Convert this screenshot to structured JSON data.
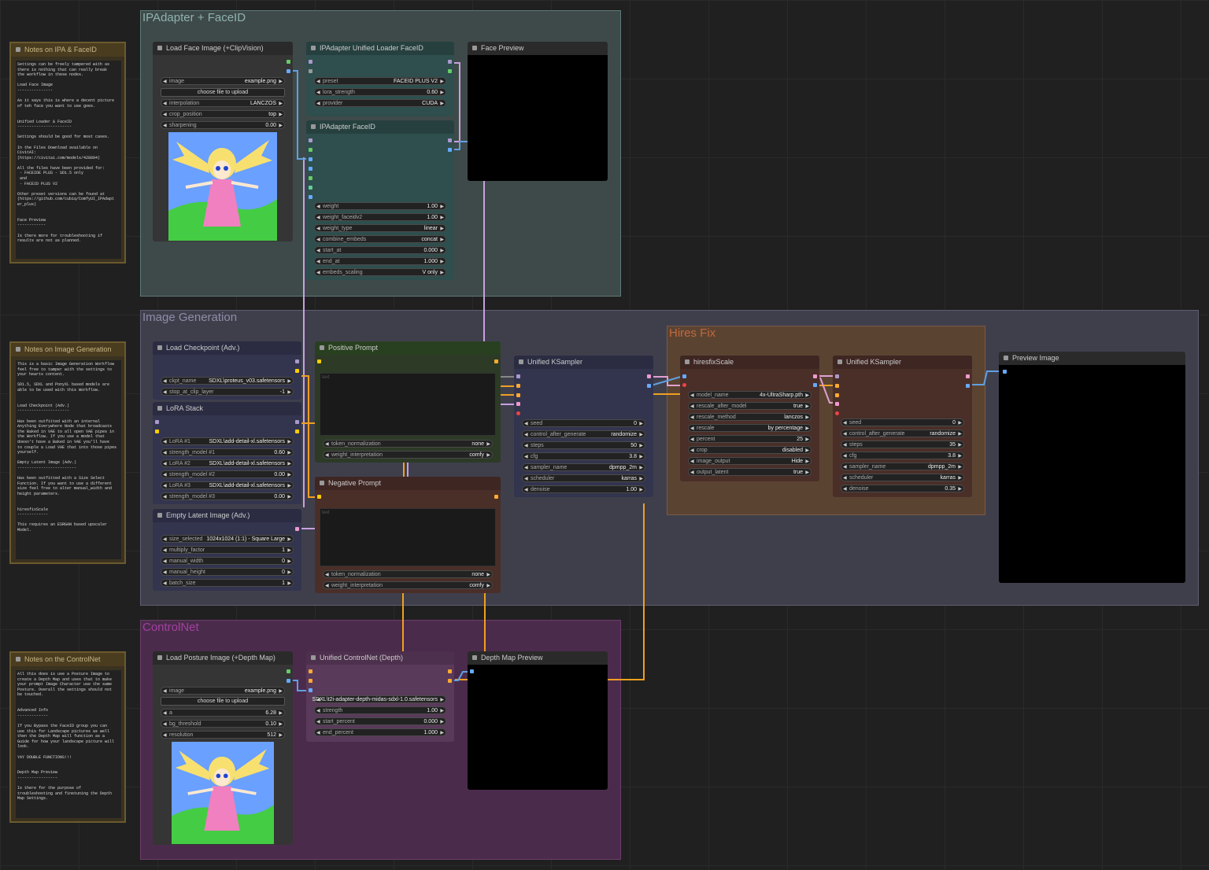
{
  "groups": {
    "ipadapter": "IPAdapter + FaceID",
    "image_generation": "Image Generation",
    "hires_fix": "Hires Fix",
    "controlnet": "ControlNet"
  },
  "notes": {
    "ipa": {
      "title": "Notes on IPA & FaceID",
      "body": "Settings can be freely tampered with as\nthere is nothing that can really break\nthe workflow in these nodes.\n\nLoad Face Image\n---------------\n\nAs it says this is where a decent picture\nof teh face you want to use goes.\n\n\nUnified Loader & FaceID\n-----------------------\n\nSettings should be good for most cases.\n\nIn the Files Download available on\nCivitAI:\n(https://civitai.com/models/428894)\n\nAll the files have been provided for:\n - FACEIDE PLUS - SD1.5 only\n and\n - FACEID PLUS V2\n\nOther preset versions can be found at\n(https://github.com/cubiq/ComfyUI_IPAdapt\ner_plus)\n\n\nFace Preview\n------------\n\nIs there more for troubleshooting if\nresults are not as planned."
    },
    "imggen": {
      "title": "Notes on Image Generation",
      "body": "This is a basic Image Generation Workflow\nfeel free to tamper with the settings to\nyour hearts content.\n\nSD1.5, SDXL and PonyXL based models are\nable to be used with this Workflow.\n\n\nLoad Checkpoint (Adv.)\n----------------------\n\nHas been outfitted with an internal\nAnything Everywhere Node that broadcasts\nthe Baked in VAE to all open VAE pipes in\nthe Workflow. If you use a model that\ndoesn't have a Baked in VAE you'll have\nto couple a Load VAE that into those pipes\nyourself.\n\nEmpty Latent Image (Adv.)\n-------------------------\n\nHas been outfitted with a Size Select\nFunction. If you want to use a different\nsize feel free to alter manual_width and\nheight parameters.\n\n\nhiresfixScale\n-------------\n\nThis requires an ESRGAN based upscaler\nModel."
    },
    "controlnet": {
      "title": "Notes on the ControlNet",
      "body": "All this does is use a Posture Image to\ncreate a Depth Map and uses that to make\nyour prompt Image Character use the same\nPosture. Overall the settings should not\nbe touched.\n\n\nAdvanced Info\n-------------\n\nIf you Bypass the FaceID group you can\nuse this for Landscape pictures as well\nthen the Depth Map will function as a\nGuide for how your landscape picture will\nlook.\n\nYAY DOUBLE FUNCTIONS!!!\n\n\nDepth Map Preview\n-----------------\n\nIs there for the purpose of\ntroubleshooting and finetuning the Depth\nMap Settings."
    }
  },
  "nodes": {
    "load_face": {
      "title": "Load Face Image (+ClipVision)",
      "widgets": [
        {
          "label": "image",
          "value": "example.png"
        },
        {
          "label": "interpolation",
          "value": "LANCZOS"
        },
        {
          "label": "crop_position",
          "value": "top"
        },
        {
          "label": "sharpening",
          "value": "0.00"
        }
      ],
      "upload_label": "choose file to upload"
    },
    "ipa_loader": {
      "title": "IPAdapter Unified Loader FaceID",
      "widgets": [
        {
          "label": "preset",
          "value": "FACEID PLUS V2"
        },
        {
          "label": "lora_strength",
          "value": "0.60"
        },
        {
          "label": "provider",
          "value": "CUDA"
        }
      ]
    },
    "ipa_faceid": {
      "title": "IPAdapter FaceID",
      "widgets": [
        {
          "label": "weight",
          "value": "1.00"
        },
        {
          "label": "weight_faceidv2",
          "value": "1.00"
        },
        {
          "label": "weight_type",
          "value": "linear"
        },
        {
          "label": "combine_embeds",
          "value": "concat"
        },
        {
          "label": "start_at",
          "value": "0.000"
        },
        {
          "label": "end_at",
          "value": "1.000"
        },
        {
          "label": "embeds_scaling",
          "value": "V only"
        }
      ]
    },
    "face_preview": {
      "title": "Face Preview"
    },
    "load_checkpoint": {
      "title": "Load Checkpoint (Adv.)",
      "widgets": [
        {
          "label": "ckpt_name",
          "value": "SDXL\\proteus_v03.safetensors"
        },
        {
          "label": "stop_at_clip_layer",
          "value": "-1"
        }
      ]
    },
    "lora_stack": {
      "title": "LoRA Stack",
      "widgets": [
        {
          "label": "LoRA #1",
          "value": "SDXL\\add-detail-xl.safetensors"
        },
        {
          "label": "strength_model #1",
          "value": "0.60"
        },
        {
          "label": "LoRA #2",
          "value": "SDXL\\add-detail-xl.safetensors"
        },
        {
          "label": "strength_model #2",
          "value": "0.00"
        },
        {
          "label": "LoRA #3",
          "value": "SDXL\\add-detail-xl.safetensors"
        },
        {
          "label": "strength_model #3",
          "value": "0.00"
        }
      ]
    },
    "empty_latent": {
      "title": "Empty Latent Image (Adv.)",
      "widgets": [
        {
          "label": "size_selected",
          "value": "1024x1024 (1:1) - Square Large"
        },
        {
          "label": "multiply_factor",
          "value": "1"
        },
        {
          "label": "manual_width",
          "value": "0"
        },
        {
          "label": "manual_height",
          "value": "0"
        },
        {
          "label": "batch_size",
          "value": "1"
        }
      ]
    },
    "positive_prompt": {
      "title": "Positive Prompt",
      "placeholder": "text",
      "widgets": [
        {
          "label": "token_normalization",
          "value": "none"
        },
        {
          "label": "weight_interpretation",
          "value": "comfy"
        }
      ]
    },
    "negative_prompt": {
      "title": "Negative Prompt",
      "placeholder": "text",
      "widgets": [
        {
          "label": "token_normalization",
          "value": "none"
        },
        {
          "label": "weight_interpretation",
          "value": "comfy"
        }
      ]
    },
    "ksampler1": {
      "title": "Unified KSampler",
      "widgets": [
        {
          "label": "seed",
          "value": "0"
        },
        {
          "label": "control_after_generate",
          "value": "randomize"
        },
        {
          "label": "steps",
          "value": "50"
        },
        {
          "label": "cfg",
          "value": "3.8"
        },
        {
          "label": "sampler_name",
          "value": "dpmpp_2m"
        },
        {
          "label": "scheduler",
          "value": "karras"
        },
        {
          "label": "denoise",
          "value": "1.00"
        }
      ]
    },
    "hiresfix": {
      "title": "hiresfixScale",
      "widgets": [
        {
          "label": "model_name",
          "value": "4x-UltraSharp.pth"
        },
        {
          "label": "rescale_after_model",
          "value": "true"
        },
        {
          "label": "rescale_method",
          "value": "lanczos"
        },
        {
          "label": "rescale",
          "value": "by percentage"
        },
        {
          "label": "percent",
          "value": "25"
        },
        {
          "label": "crop",
          "value": "disabled"
        },
        {
          "label": "image_output",
          "value": "Hide"
        },
        {
          "label": "output_latent",
          "value": "true"
        }
      ]
    },
    "ksampler2": {
      "title": "Unified KSampler",
      "widgets": [
        {
          "label": "seed",
          "value": "0"
        },
        {
          "label": "control_after_generate",
          "value": "randomize"
        },
        {
          "label": "steps",
          "value": "35"
        },
        {
          "label": "cfg",
          "value": "3.8"
        },
        {
          "label": "sampler_name",
          "value": "dpmpp_2m"
        },
        {
          "label": "scheduler",
          "value": "karras"
        },
        {
          "label": "denoise",
          "value": "0.35"
        }
      ]
    },
    "preview_image": {
      "title": "Preview Image"
    },
    "load_posture": {
      "title": "Load Posture Image (+Depth Map)",
      "widgets": [
        {
          "label": "image",
          "value": "example.png"
        },
        {
          "label": "a",
          "value": "6.28"
        },
        {
          "label": "bg_threshold",
          "value": "0.10"
        },
        {
          "label": "resolution",
          "value": "512"
        }
      ],
      "upload_label": "choose file to upload"
    },
    "controlnet": {
      "title": "Unified ControlNet (Depth)",
      "widgets": [
        {
          "label": "",
          "value": "SDXL\\t2i-adapter-depth-midas-sdxl-1.0.safetensors"
        },
        {
          "label": "strength",
          "value": "1.00"
        },
        {
          "label": "start_percent",
          "value": "0.000"
        },
        {
          "label": "end_percent",
          "value": "1.000"
        }
      ]
    },
    "depth_preview": {
      "title": "Depth Map Preview"
    }
  },
  "colors": {
    "group_ipadapter": "#3e4a49",
    "group_imggen": "#3f3f4c",
    "group_hires": "#5b4332",
    "group_controlnet": "#4b2b4b",
    "node_teal": "#2f4e4e",
    "node_green": "#2c3a26",
    "node_brown": "#4a2e28",
    "node_navy": "#33344e",
    "node_grey": "#353535",
    "wire_orange": "#f0a020",
    "wire_lilac": "#c8a0e0",
    "wire_blue": "#60a0e0",
    "wire_pink": "#e0a0d0"
  }
}
